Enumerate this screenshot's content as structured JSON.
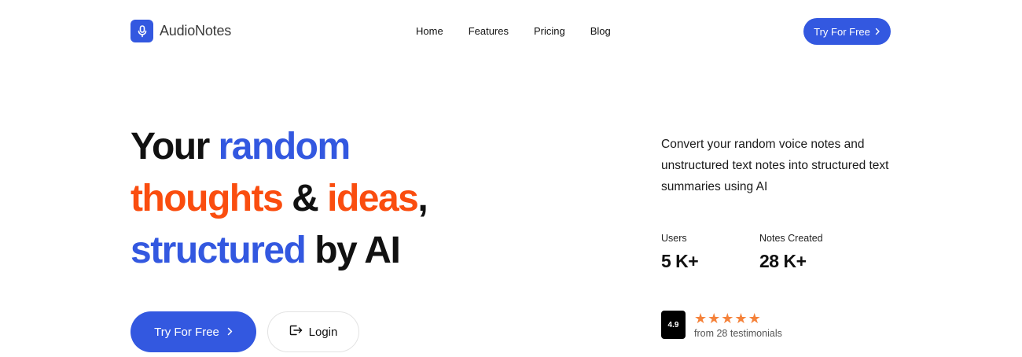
{
  "brand": {
    "name": "AudioNotes",
    "logo_icon": "microphone-icon",
    "accent": "#3358e0"
  },
  "nav": {
    "items": [
      "Home",
      "Features",
      "Pricing",
      "Blog"
    ]
  },
  "header_cta": {
    "label": "Try For Free",
    "icon": "chevron-right-icon"
  },
  "hero": {
    "line1": {
      "w1": "Your",
      "w2": "random"
    },
    "line2": {
      "w1": "thoughts",
      "w2": "&",
      "w3": "ideas",
      "w4": ","
    },
    "line3": {
      "w1": "structured",
      "w2": "by AI"
    },
    "colors": {
      "blue": "#3358e0",
      "orange": "#fa4d0f"
    }
  },
  "actions": {
    "primary_label": "Try For Free",
    "secondary_label": "Login",
    "secondary_icon": "login-icon"
  },
  "description": "Convert your random voice notes and unstructured text notes into structured text summaries using AI",
  "stats": [
    {
      "label": "Users",
      "value": "5 K+"
    },
    {
      "label": "Notes Created",
      "value": "28 K+"
    }
  ],
  "rating": {
    "score": "4.9",
    "stars": 5,
    "text": "from 28 testimonials",
    "star_color": "#f5823a"
  }
}
